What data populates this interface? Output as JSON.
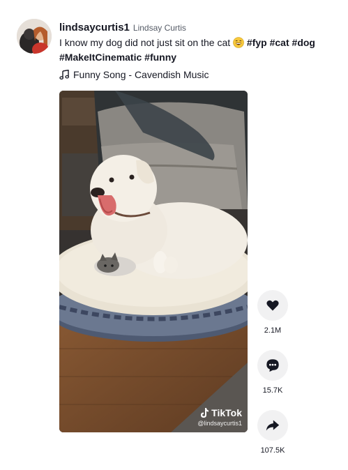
{
  "post": {
    "username": "lindsaycurtis1",
    "nickname": "Lindsay Curtis",
    "caption_text": "I know my dog did not just sit on the cat",
    "hashtags_line1": [
      "#fyp",
      "#cat",
      "#dog"
    ],
    "hashtags_line2": [
      "#MakeItCinematic",
      "#funny"
    ],
    "music": "Funny Song - Cavendish Music"
  },
  "watermark": {
    "brand": "TikTok",
    "handle": "@lindsaycurtis1"
  },
  "actions": {
    "likes": "2.1M",
    "comments": "15.7K",
    "shares": "107.5K"
  },
  "icons": {
    "like": "heart-icon",
    "comment": "comment-dots-icon",
    "share": "share-arrow-icon",
    "music": "music-note-icon",
    "emoji": "laughing-emoji-icon"
  }
}
